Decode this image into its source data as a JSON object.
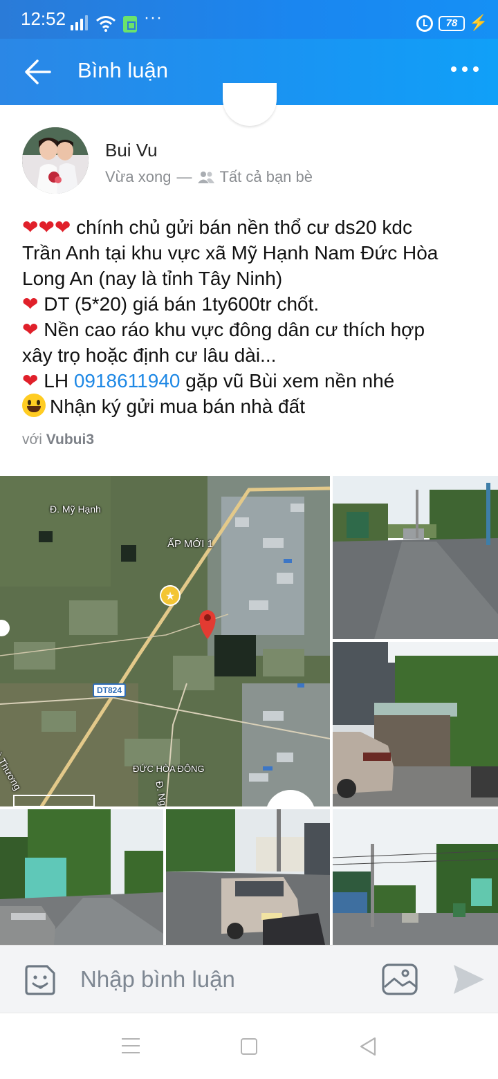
{
  "status_bar": {
    "time": "12:52",
    "dots": "···",
    "battery": "78",
    "icons": [
      "signal-icon",
      "wifi-icon",
      "sim-icon",
      "alarm-icon",
      "battery-icon",
      "charging-icon"
    ]
  },
  "app_bar": {
    "title": "Bình luận",
    "icons": [
      "back-arrow-icon",
      "more-options-icon"
    ]
  },
  "post": {
    "author": "Bui Vu",
    "time": "Vừa xong",
    "separator": "—",
    "audience": "Tất cả bạn bè",
    "hearts": "❤❤❤",
    "heart": "❤",
    "line1": " chính chủ gửi bán nền thổ cư ds20 kdc",
    "line2": "Trần Anh tại khu vực xã Mỹ Hạnh Nam Đức Hòa",
    "line3": "Long An (nay là tỉnh Tây Ninh)",
    "line4": " DT (5*20) giá bán 1ty600tr chốt.",
    "line5": " Nền cao ráo khu vực đông dân cư thích hợp",
    "line6": "xây trọ hoặc định cư lâu dài...",
    "line7_prefix": " LH ",
    "phone": "0918611940",
    "line7_suffix": " gặp vũ Bùi xem nền nhé",
    "line8": "Nhận ký gửi mua bán nhà đất",
    "tagged_prefix": "với ",
    "tagged_name": "Vubui3"
  },
  "map": {
    "labels": {
      "my_hanh": "Đ. Mỹ Hạnh",
      "ap_moi": "ẤP MỚI 1",
      "dt824": "DT824",
      "duc_hoa_dong": "ĐỨC HÒA ĐÔNG",
      "hoa_thuong": "Hoà Thương",
      "d_ng": "Đ. Ng"
    }
  },
  "photos": [
    "map-photo",
    "road-photo",
    "car-house-photo",
    "street-tree-photo",
    "parked-car-photo",
    "street-view-photo"
  ],
  "comment_bar": {
    "placeholder": "Nhập bình luận",
    "icons": [
      "sticker-icon",
      "image-icon",
      "send-icon"
    ]
  },
  "nav_bar": {
    "icons": [
      "menu-icon",
      "home-icon",
      "back-icon"
    ]
  },
  "colors": {
    "app_bar": "#1a93f2",
    "link": "#1e88e5",
    "heart": "#e0202a",
    "secondary_text": "#8a8d91"
  }
}
